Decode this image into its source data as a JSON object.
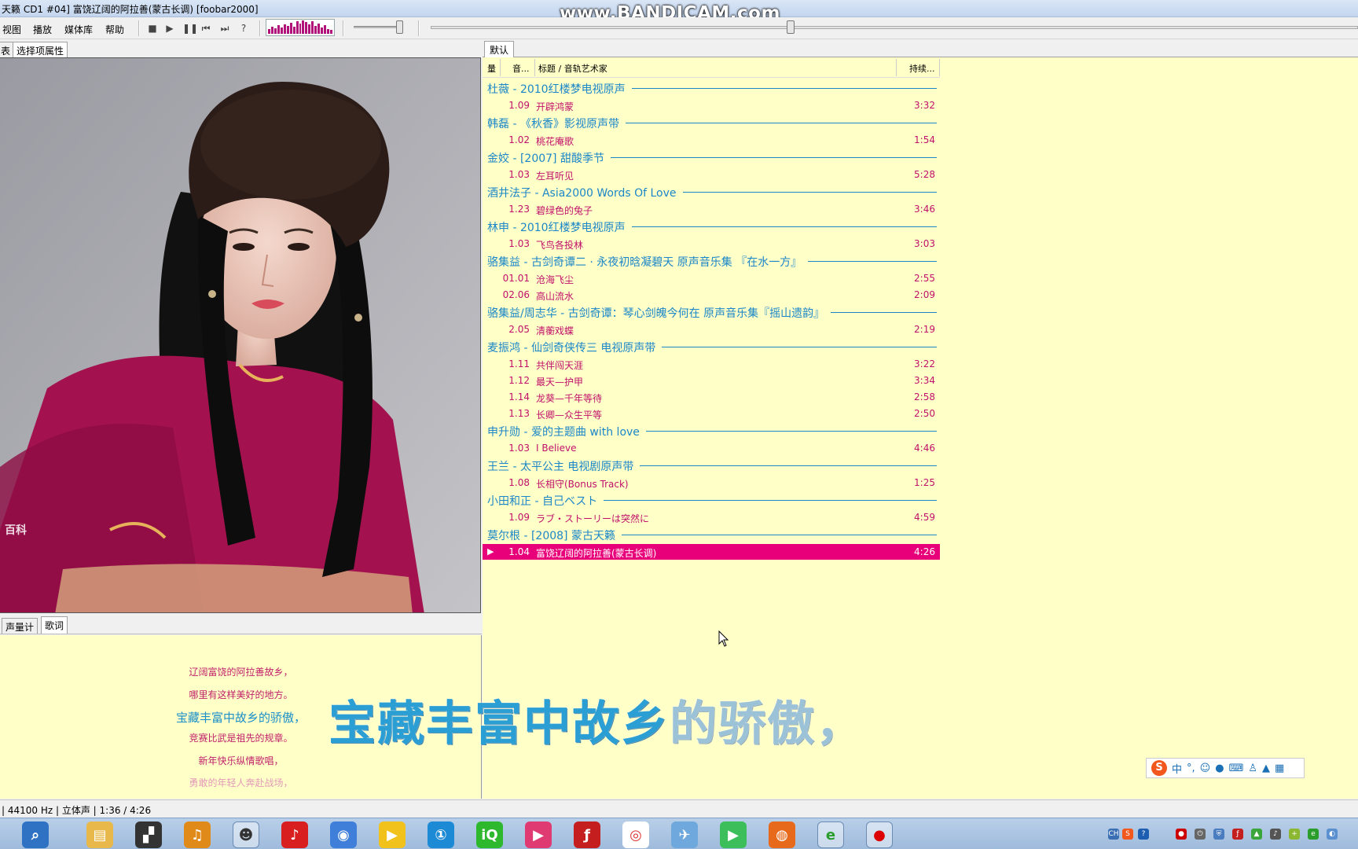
{
  "window": {
    "title": "天籁 CD1 #04] 富饶辽阔的阿拉善(蒙古长调)  [foobar2000]",
    "watermark": "www.BANDICAM.com"
  },
  "menu": [
    "视图",
    "播放",
    "媒体库",
    "帮助"
  ],
  "left_tabs": [
    "表",
    "选择项属性"
  ],
  "bottom_tabs": [
    "声量计",
    "歌词"
  ],
  "album_art_watermark": "百科",
  "lyrics": {
    "lines": [
      "辽阔富饶的阿拉善故乡，",
      "哪里有这样美好的地方。",
      "宝藏丰富中故乡的骄傲，",
      "竞赛比武是祖先的规章。",
      "新年快乐纵情歌唱，",
      "勇敢的年轻人奔赴战场，"
    ],
    "overlay_sung": "宝藏丰富中故乡",
    "overlay_unsung": "的骄傲，"
  },
  "playlist": {
    "tab": "默认",
    "columns": [
      "量",
      "音...",
      "标题 / 音轨艺术家",
      "持续..."
    ],
    "groups": [
      {
        "title": "杜薇 - 2010红楼梦电视原声",
        "tracks": [
          {
            "num": "1.09",
            "name": "开辟鸿蒙",
            "dur": "3:32"
          }
        ]
      },
      {
        "title": "韩磊 - 《秋香》影视原声带",
        "tracks": [
          {
            "num": "1.02",
            "name": "桃花庵歌",
            "dur": "1:54"
          }
        ]
      },
      {
        "title": "金姣 - [2007] 甜酸季节",
        "tracks": [
          {
            "num": "1.03",
            "name": "左耳听见",
            "dur": "5:28"
          }
        ]
      },
      {
        "title": "酒井法子 - Asia2000 Words Of Love",
        "tracks": [
          {
            "num": "1.23",
            "name": "碧绿色的兔子",
            "dur": "3:46"
          }
        ]
      },
      {
        "title": "林申 - 2010红楼梦电视原声",
        "tracks": [
          {
            "num": "1.03",
            "name": "飞鸟各投林",
            "dur": "3:03"
          }
        ]
      },
      {
        "title": "骆集益 - 古剑奇谭二 · 永夜初晗凝碧天 原声音乐集 『在水一方』",
        "tracks": [
          {
            "num": "01.01",
            "name": "沧海飞尘",
            "dur": "2:55"
          },
          {
            "num": "02.06",
            "name": "高山流水",
            "dur": "2:09"
          }
        ]
      },
      {
        "title": "骆集益/周志华 - 古剑奇谭：琴心剑魄今何在 原声音乐集『摇山遗韵』",
        "tracks": [
          {
            "num": "2.05",
            "name": "清蘅戏蝶",
            "dur": "2:19"
          }
        ]
      },
      {
        "title": "麦振鸿 - 仙剑奇侠传三 电视原声带",
        "tracks": [
          {
            "num": "1.11",
            "name": "共伴闯天涯",
            "dur": "3:22"
          },
          {
            "num": "1.12",
            "name": "最天—护甲",
            "dur": "3:34"
          },
          {
            "num": "1.14",
            "name": "龙葵—千年等待",
            "dur": "2:58"
          },
          {
            "num": "1.13",
            "name": "长卿—众生平等",
            "dur": "2:50"
          }
        ]
      },
      {
        "title": "申升勋 - 爱的主题曲 with love",
        "tracks": [
          {
            "num": "1.03",
            "name": "I Believe",
            "dur": "4:46"
          }
        ]
      },
      {
        "title": "王兰 - 太平公主 电视剧原声带",
        "tracks": [
          {
            "num": "1.08",
            "name": "长相守(Bonus Track)",
            "dur": "1:25"
          }
        ]
      },
      {
        "title": "小田和正 - 自己ベスト",
        "tracks": [
          {
            "num": "1.09",
            "name": "ラブ・ストーリーは突然に",
            "dur": "4:59"
          }
        ]
      },
      {
        "title": "莫尔根 - [2008] 蒙古天籁",
        "tracks": [
          {
            "num": "1.04",
            "name": "富饶辽阔的阿拉善(蒙古长调)",
            "dur": "4:26",
            "playing": true
          }
        ]
      }
    ]
  },
  "status": "| 44100 Hz | 立体声 | 1:36 / 4:26",
  "ime": {
    "label": "中"
  },
  "colors": {
    "accent": "#1b86c8",
    "track_text": "#c0106a",
    "playing_bg": "#e8007a",
    "panel_bg": "#ffffc8"
  },
  "taskbar_icons": [
    "search-icon",
    "explorer-icon",
    "clapper-icon",
    "headphones-icon",
    "alien-icon",
    "netease-music-icon",
    "chrome-like-icon",
    "player-icon",
    "clock-icon",
    "iqiyi-icon",
    "youku-icon",
    "flash-icon",
    "chrome-icon",
    "bird-icon",
    "play-store-icon",
    "firefox-icon",
    "green-app-icon",
    "record-icon"
  ]
}
